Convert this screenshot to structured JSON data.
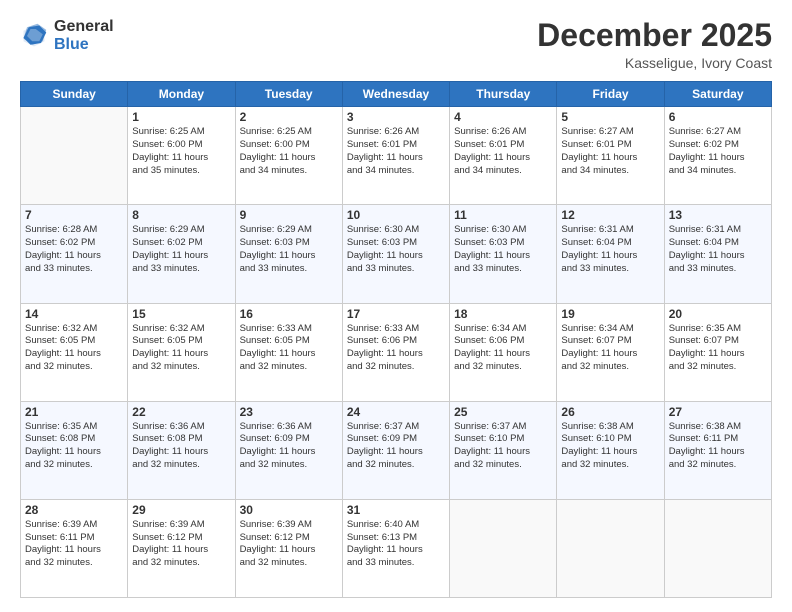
{
  "logo": {
    "general": "General",
    "blue": "Blue"
  },
  "header": {
    "month": "December 2025",
    "location": "Kasseligue, Ivory Coast"
  },
  "days_of_week": [
    "Sunday",
    "Monday",
    "Tuesday",
    "Wednesday",
    "Thursday",
    "Friday",
    "Saturday"
  ],
  "weeks": [
    [
      {
        "day": null
      },
      {
        "day": 1,
        "sunrise": "6:25 AM",
        "sunset": "6:00 PM",
        "daylight": "11 hours and 35 minutes."
      },
      {
        "day": 2,
        "sunrise": "6:25 AM",
        "sunset": "6:00 PM",
        "daylight": "11 hours and 34 minutes."
      },
      {
        "day": 3,
        "sunrise": "6:26 AM",
        "sunset": "6:01 PM",
        "daylight": "11 hours and 34 minutes."
      },
      {
        "day": 4,
        "sunrise": "6:26 AM",
        "sunset": "6:01 PM",
        "daylight": "11 hours and 34 minutes."
      },
      {
        "day": 5,
        "sunrise": "6:27 AM",
        "sunset": "6:01 PM",
        "daylight": "11 hours and 34 minutes."
      },
      {
        "day": 6,
        "sunrise": "6:27 AM",
        "sunset": "6:02 PM",
        "daylight": "11 hours and 34 minutes."
      }
    ],
    [
      {
        "day": 7,
        "sunrise": "6:28 AM",
        "sunset": "6:02 PM",
        "daylight": "11 hours and 33 minutes."
      },
      {
        "day": 8,
        "sunrise": "6:29 AM",
        "sunset": "6:02 PM",
        "daylight": "11 hours and 33 minutes."
      },
      {
        "day": 9,
        "sunrise": "6:29 AM",
        "sunset": "6:03 PM",
        "daylight": "11 hours and 33 minutes."
      },
      {
        "day": 10,
        "sunrise": "6:30 AM",
        "sunset": "6:03 PM",
        "daylight": "11 hours and 33 minutes."
      },
      {
        "day": 11,
        "sunrise": "6:30 AM",
        "sunset": "6:03 PM",
        "daylight": "11 hours and 33 minutes."
      },
      {
        "day": 12,
        "sunrise": "6:31 AM",
        "sunset": "6:04 PM",
        "daylight": "11 hours and 33 minutes."
      },
      {
        "day": 13,
        "sunrise": "6:31 AM",
        "sunset": "6:04 PM",
        "daylight": "11 hours and 33 minutes."
      }
    ],
    [
      {
        "day": 14,
        "sunrise": "6:32 AM",
        "sunset": "6:05 PM",
        "daylight": "11 hours and 32 minutes."
      },
      {
        "day": 15,
        "sunrise": "6:32 AM",
        "sunset": "6:05 PM",
        "daylight": "11 hours and 32 minutes."
      },
      {
        "day": 16,
        "sunrise": "6:33 AM",
        "sunset": "6:05 PM",
        "daylight": "11 hours and 32 minutes."
      },
      {
        "day": 17,
        "sunrise": "6:33 AM",
        "sunset": "6:06 PM",
        "daylight": "11 hours and 32 minutes."
      },
      {
        "day": 18,
        "sunrise": "6:34 AM",
        "sunset": "6:06 PM",
        "daylight": "11 hours and 32 minutes."
      },
      {
        "day": 19,
        "sunrise": "6:34 AM",
        "sunset": "6:07 PM",
        "daylight": "11 hours and 32 minutes."
      },
      {
        "day": 20,
        "sunrise": "6:35 AM",
        "sunset": "6:07 PM",
        "daylight": "11 hours and 32 minutes."
      }
    ],
    [
      {
        "day": 21,
        "sunrise": "6:35 AM",
        "sunset": "6:08 PM",
        "daylight": "11 hours and 32 minutes."
      },
      {
        "day": 22,
        "sunrise": "6:36 AM",
        "sunset": "6:08 PM",
        "daylight": "11 hours and 32 minutes."
      },
      {
        "day": 23,
        "sunrise": "6:36 AM",
        "sunset": "6:09 PM",
        "daylight": "11 hours and 32 minutes."
      },
      {
        "day": 24,
        "sunrise": "6:37 AM",
        "sunset": "6:09 PM",
        "daylight": "11 hours and 32 minutes."
      },
      {
        "day": 25,
        "sunrise": "6:37 AM",
        "sunset": "6:10 PM",
        "daylight": "11 hours and 32 minutes."
      },
      {
        "day": 26,
        "sunrise": "6:38 AM",
        "sunset": "6:10 PM",
        "daylight": "11 hours and 32 minutes."
      },
      {
        "day": 27,
        "sunrise": "6:38 AM",
        "sunset": "6:11 PM",
        "daylight": "11 hours and 32 minutes."
      }
    ],
    [
      {
        "day": 28,
        "sunrise": "6:39 AM",
        "sunset": "6:11 PM",
        "daylight": "11 hours and 32 minutes."
      },
      {
        "day": 29,
        "sunrise": "6:39 AM",
        "sunset": "6:12 PM",
        "daylight": "11 hours and 32 minutes."
      },
      {
        "day": 30,
        "sunrise": "6:39 AM",
        "sunset": "6:12 PM",
        "daylight": "11 hours and 32 minutes."
      },
      {
        "day": 31,
        "sunrise": "6:40 AM",
        "sunset": "6:13 PM",
        "daylight": "11 hours and 33 minutes."
      },
      {
        "day": null
      },
      {
        "day": null
      },
      {
        "day": null
      }
    ]
  ]
}
